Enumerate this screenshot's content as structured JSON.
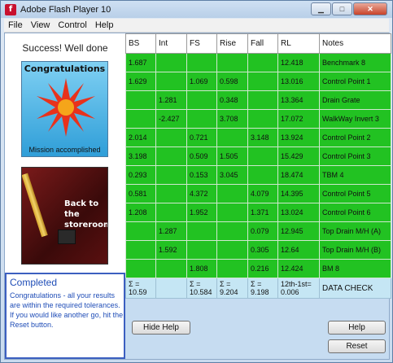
{
  "window": {
    "title": "Adobe Flash Player 10",
    "icon_letter": "f",
    "min_glyph": "▁",
    "max_glyph": "□",
    "close_glyph": "✕"
  },
  "menu": [
    {
      "label": "File"
    },
    {
      "label": "View"
    },
    {
      "label": "Control"
    },
    {
      "label": "Help"
    }
  ],
  "left": {
    "success_text": "Success! Well done",
    "congrats_title": "Congratulations",
    "congrats_sub": "Mission accomplished",
    "store_text": "Back to the storeroom!"
  },
  "help": {
    "title": "Completed",
    "body": "Congratulations - all your results are within the required tolerances. If you would like another go, hit the Reset button."
  },
  "table": {
    "headers": [
      "BS",
      "Int",
      "FS",
      "Rise",
      "Fall",
      "RL",
      "Notes"
    ],
    "rows": [
      [
        "1.687",
        "",
        "",
        "",
        "",
        "12.418",
        "Benchmark 8"
      ],
      [
        "1.629",
        "",
        "1.069",
        "0.598",
        "",
        "13.016",
        "Control Point 1"
      ],
      [
        "",
        "1.281",
        "",
        "0.348",
        "",
        "13.364",
        "Drain Grate"
      ],
      [
        "",
        "-2.427",
        "",
        "3.708",
        "",
        "17.072",
        "WalkWay Invert 3"
      ],
      [
        "2.014",
        "",
        "0.721",
        "",
        "3.148",
        "13.924",
        "Control Point 2"
      ],
      [
        "3.198",
        "",
        "0.509",
        "1.505",
        "",
        "15.429",
        "Control Point 3"
      ],
      [
        "0.293",
        "",
        "0.153",
        "3.045",
        "",
        "18.474",
        "TBM 4"
      ],
      [
        "0.581",
        "",
        "4.372",
        "",
        "4.079",
        "14.395",
        "Control Point 5"
      ],
      [
        "1.208",
        "",
        "1.952",
        "",
        "1.371",
        "13.024",
        "Control Point 6"
      ],
      [
        "",
        "1.287",
        "",
        "",
        "0.079",
        "12.945",
        "Top Drain M/H (A)"
      ],
      [
        "",
        "1.592",
        "",
        "",
        "0.305",
        "12.64",
        "Top Drain M/H (B)"
      ],
      [
        "",
        "",
        "1.808",
        "",
        "0.216",
        "12.424",
        "BM 8"
      ]
    ],
    "sum_row": [
      "Σ = 10.59",
      "",
      "Σ = 10.584",
      "Σ = 9.204",
      "Σ = 9.198",
      "12th-1st= 0.006",
      "DATA CHECK"
    ]
  },
  "buttons": {
    "hide_help": "Hide Help",
    "help": "Help",
    "reset": "Reset"
  }
}
